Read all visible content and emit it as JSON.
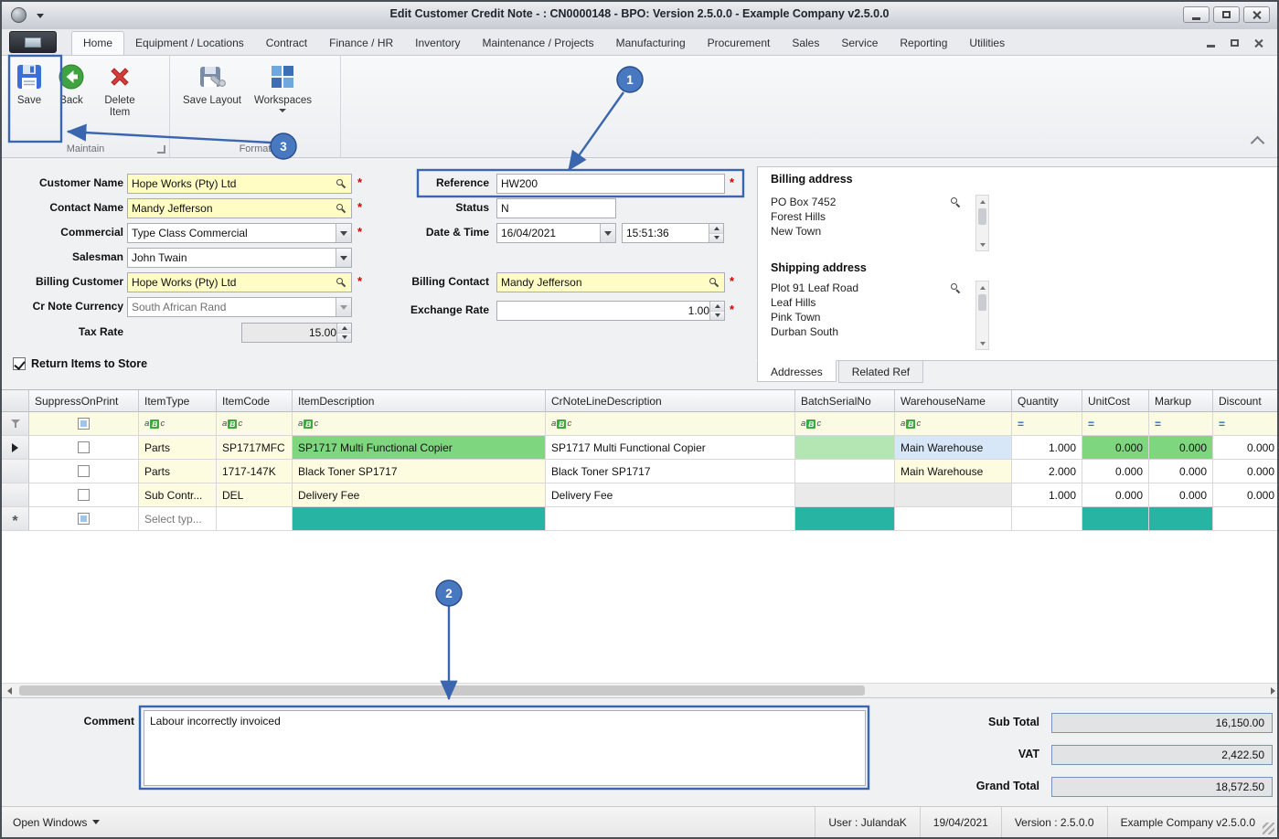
{
  "titlebar": {
    "title": "Edit Customer Credit Note - : CN0000148 - BPO: Version 2.5.0.0 - Example Company v2.5.0.0"
  },
  "ribbon": {
    "tabs": [
      "Home",
      "Equipment / Locations",
      "Contract",
      "Finance / HR",
      "Inventory",
      "Maintenance / Projects",
      "Manufacturing",
      "Procurement",
      "Sales",
      "Service",
      "Reporting",
      "Utilities"
    ],
    "buttons": {
      "save": "Save",
      "back": "Back",
      "delete_item": "Delete Item",
      "save_layout": "Save Layout",
      "workspaces": "Workspaces"
    },
    "groups": {
      "maintain": "Maintain",
      "format": "Format"
    }
  },
  "form": {
    "customer_name": {
      "label": "Customer Name",
      "value": "Hope Works (Pty) Ltd"
    },
    "contact_name": {
      "label": "Contact Name",
      "value": "Mandy Jefferson"
    },
    "commercial": {
      "label": "Commercial",
      "value": "Type Class Commercial"
    },
    "salesman": {
      "label": "Salesman",
      "value": "John Twain"
    },
    "billing_customer": {
      "label": "Billing Customer",
      "value": "Hope Works (Pty) Ltd"
    },
    "cr_note_currency": {
      "label": "Cr Note Currency",
      "value": "South African Rand"
    },
    "tax_rate": {
      "label": "Tax Rate",
      "value": "15.00"
    },
    "reference": {
      "label": "Reference",
      "value": "HW200"
    },
    "status": {
      "label": "Status",
      "value": "N"
    },
    "date_time": {
      "label": "Date & Time",
      "date": "16/04/2021",
      "time": "15:51:36"
    },
    "billing_contact": {
      "label": "Billing Contact",
      "value": "Mandy Jefferson"
    },
    "exchange_rate": {
      "label": "Exchange Rate",
      "value": "1.00"
    },
    "return_items": {
      "label": "Return Items to Store",
      "checked": true
    }
  },
  "addresses": {
    "billing_label": "Billing address",
    "billing": "PO Box 7452\nForest Hills\nNew Town",
    "shipping_label": "Shipping address",
    "shipping": "Plot 91 Leaf Road\nLeaf Hills\nPink Town\nDurban South",
    "tab_addresses": "Addresses",
    "tab_related_ref": "Related Ref"
  },
  "grid": {
    "columns": [
      "SuppressOnPrint",
      "ItemType",
      "ItemCode",
      "ItemDescription",
      "CrNoteLineDescription",
      "BatchSerialNo",
      "WarehouseName",
      "Quantity",
      "UnitCost",
      "Markup",
      "Discount"
    ],
    "rows": [
      {
        "item_type": "Parts",
        "item_code": "SP1717MFC",
        "item_description": "SP1717 Multi Functional Copier",
        "crnote_line_description": "SP1717 Multi Functional Copier",
        "batch_serial_no": "",
        "warehouse_name": "Main Warehouse",
        "quantity": "1.000",
        "unit_cost": "0.000",
        "markup": "0.000",
        "discount": "0.000"
      },
      {
        "item_type": "Parts",
        "item_code": "1717-147K",
        "item_description": "Black Toner SP1717",
        "crnote_line_description": "Black Toner SP1717",
        "batch_serial_no": "",
        "warehouse_name": "Main Warehouse",
        "quantity": "2.000",
        "unit_cost": "0.000",
        "markup": "0.000",
        "discount": "0.000"
      },
      {
        "item_type": "Sub Contr...",
        "item_code": "DEL",
        "item_description": "Delivery Fee",
        "crnote_line_description": "Delivery Fee",
        "batch_serial_no": "",
        "warehouse_name": "",
        "quantity": "1.000",
        "unit_cost": "0.000",
        "markup": "0.000",
        "discount": "0.000"
      },
      {
        "item_type": "Select typ...",
        "item_code": "",
        "item_description": "",
        "crnote_line_description": "",
        "batch_serial_no": "",
        "warehouse_name": "",
        "quantity": "",
        "unit_cost": "",
        "markup": "",
        "discount": ""
      }
    ]
  },
  "footer": {
    "comment_label": "Comment",
    "comment_value": "Labour incorrectly invoiced",
    "sub_total_label": "Sub Total",
    "sub_total": "16,150.00",
    "vat_label": "VAT",
    "vat": "2,422.50",
    "grand_total_label": "Grand Total",
    "grand_total": "18,572.50"
  },
  "statusbar": {
    "open_windows": "Open Windows",
    "user": "User : JulandaK",
    "date": "19/04/2021",
    "version": "Version : 2.5.0.0",
    "company": "Example Company v2.5.0.0"
  },
  "annotations": {
    "badge1": "1",
    "badge2": "2",
    "badge3": "3"
  },
  "icons": {
    "required": "*",
    "new_row": "*",
    "filter_eq": "=",
    "filter_abc": [
      "a",
      "B",
      "c"
    ]
  },
  "colors": {
    "annotation_blue": "#3A66B0",
    "required_red": "#D40000",
    "editable_yellow": "#FFFCC4",
    "highlight_green": "#7ED67E",
    "new_row_teal": "#27B4A2"
  }
}
